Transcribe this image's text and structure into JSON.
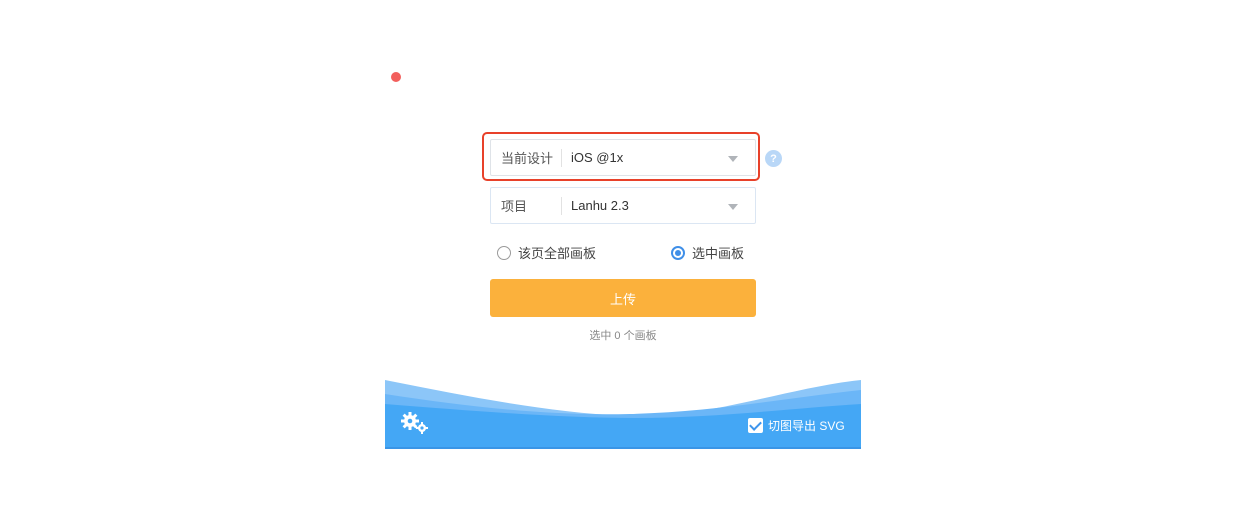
{
  "window": {
    "close_color": "#f25f5c"
  },
  "design": {
    "label": "当前设计",
    "value": "iOS @1x"
  },
  "project": {
    "label": "项目",
    "value": "Lanhu 2.3"
  },
  "help": {
    "symbol": "?"
  },
  "scope_options": [
    {
      "label": "该页全部画板",
      "checked": false
    },
    {
      "label": "选中画板",
      "checked": true
    }
  ],
  "upload": {
    "label": "上传",
    "color": "#fbb13c"
  },
  "selection_status": "选中 0 个画板",
  "footer": {
    "settings_icon": "gear-icon",
    "export_svg": {
      "label": "切图导出 SVG",
      "checked": true
    },
    "color": "#44a7f5"
  },
  "highlight_color": "#e8412a",
  "accent_color": "#3f8fe8"
}
